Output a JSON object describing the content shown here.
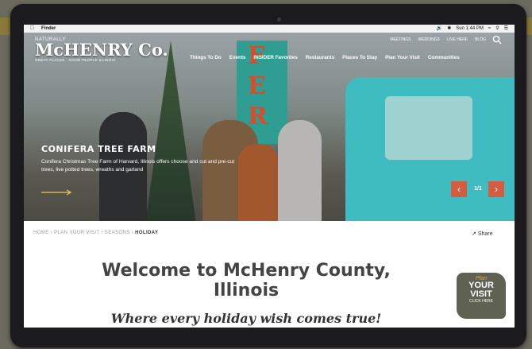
{
  "menubar": {
    "apple": "",
    "app": "Finder",
    "right": [
      "Sun 1:44 PM"
    ]
  },
  "logo": {
    "small": "NATURALLY",
    "big": "McHENRY Co.",
    "tag": "GREAT PLACES · GOOD PEOPLE",
    "state": "ILLINOIS"
  },
  "topnav": [
    "MEETINGS",
    "WEDDINGS",
    "LIVE HERE",
    "BLOG"
  ],
  "mainnav": [
    "Things To Do",
    "Events",
    "INSIDER Favorites",
    "Restaurants",
    "Places To Stay",
    "Plan Your Visit",
    "Communities"
  ],
  "hero": {
    "title": "CONIFERA TREE FARM",
    "body": "Conifera Christmas Tree Farm of Harvard, Illinois offers choose and cut and pre-cut trees, live potted trees, wreaths and garland",
    "counter": "1/1",
    "prev": "‹",
    "next": "›"
  },
  "breadcrumb": {
    "trail": "HOME › PLAN YOUR VISIT › SEASONS › ",
    "current": "HOLIDAY"
  },
  "share_label": "Share",
  "welcome": {
    "line1": "Welcome to McHenry County,",
    "line2": "Illinois"
  },
  "tagline": "Where every holiday wish comes true!",
  "badge": {
    "plan": "Plan",
    "your": "YOUR",
    "visit": "VISIT",
    "click": "CLICK HERE"
  },
  "colors": {
    "accent": "#d55c41",
    "truck": "#3fbcc0",
    "sign": "#2f9d91"
  }
}
